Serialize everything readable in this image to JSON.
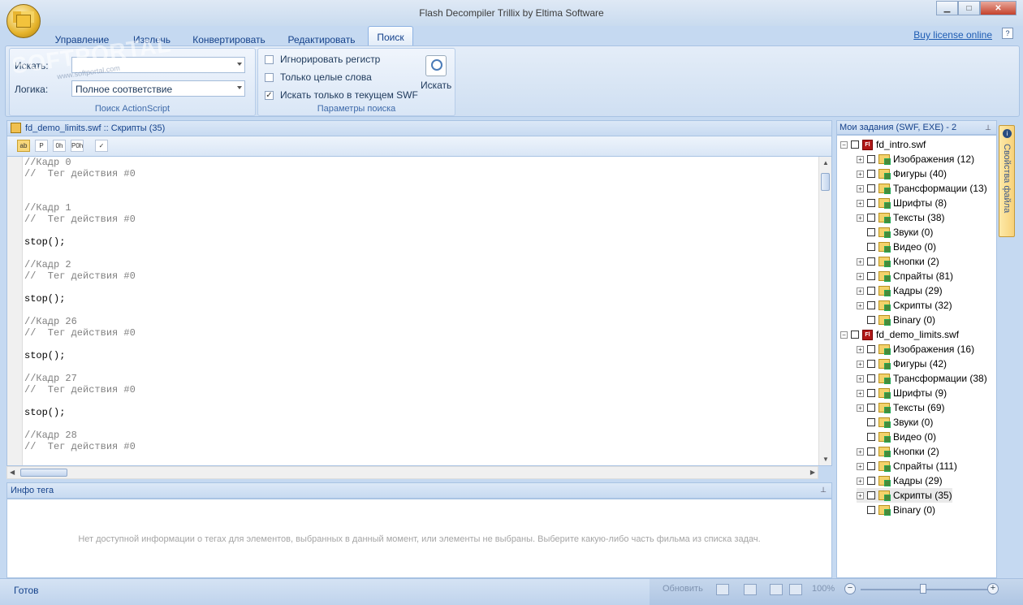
{
  "window": {
    "title": "Flash Decompiler Trillix by Eltima Software",
    "minimize": "▁",
    "maximize": "□",
    "close": "✕"
  },
  "ribbon_tabs": [
    "Управление",
    "Извлечь",
    "Конвертировать",
    "Редактировать",
    "Поиск"
  ],
  "active_tab": "Поиск",
  "buy_license": "Buy license online",
  "search_group": {
    "search_label": "Искать:",
    "search_value": "",
    "logic_label": "Логика:",
    "logic_value": "Полное соответствие",
    "group_label": "Поиск ActionScript"
  },
  "params_group": {
    "ignore_case": {
      "label": "Игнорировать регистр",
      "checked": false
    },
    "whole_words": {
      "label": "Только целые слова",
      "checked": false
    },
    "current_swf": {
      "label": "Искать только в текущем SWF",
      "checked": true
    },
    "search_button": "Искать",
    "group_label": "Параметры поиска"
  },
  "document": {
    "header": "fd_demo_limits.swf :: Скрипты (35)",
    "toolbar_buttons": [
      "ab",
      "P",
      "0h",
      "P0h",
      "✓"
    ],
    "code_lines": [
      {
        "text": "//Кадр 0",
        "kind": "comment"
      },
      {
        "text": "//  Тег действия #0",
        "kind": "comment"
      },
      {
        "text": "",
        "kind": "blank"
      },
      {
        "text": "",
        "kind": "blank"
      },
      {
        "text": "//Кадр 1",
        "kind": "comment"
      },
      {
        "text": "//  Тег действия #0",
        "kind": "comment"
      },
      {
        "text": "",
        "kind": "blank"
      },
      {
        "text": "stop();",
        "kind": "code"
      },
      {
        "text": "",
        "kind": "blank"
      },
      {
        "text": "//Кадр 2",
        "kind": "comment"
      },
      {
        "text": "//  Тег действия #0",
        "kind": "comment"
      },
      {
        "text": "",
        "kind": "blank"
      },
      {
        "text": "stop();",
        "kind": "code"
      },
      {
        "text": "",
        "kind": "blank"
      },
      {
        "text": "//Кадр 26",
        "kind": "comment"
      },
      {
        "text": "//  Тег действия #0",
        "kind": "comment"
      },
      {
        "text": "",
        "kind": "blank"
      },
      {
        "text": "stop();",
        "kind": "code"
      },
      {
        "text": "",
        "kind": "blank"
      },
      {
        "text": "//Кадр 27",
        "kind": "comment"
      },
      {
        "text": "//  Тег действия #0",
        "kind": "comment"
      },
      {
        "text": "",
        "kind": "blank"
      },
      {
        "text": "stop();",
        "kind": "code"
      },
      {
        "text": "",
        "kind": "blank"
      },
      {
        "text": "//Кадр 28",
        "kind": "comment"
      },
      {
        "text": "//  Тег действия #0",
        "kind": "comment"
      }
    ]
  },
  "info_panel": {
    "header": "Инфо тега",
    "message": "Нет доступной информации о тегах для элементов, выбранных в данный момент, или элементы не выбраны. Выберите какую-либо часть фильма из списка задач."
  },
  "tasks_panel": {
    "header": "Мои задания (SWF, EXE) - 2",
    "files": [
      {
        "name": "fd_intro.swf",
        "items": [
          "Изображения (12)",
          "Фигуры (40)",
          "Трансформации (13)",
          "Шрифты (8)",
          "Тексты (38)",
          "Звуки (0)",
          "Видео (0)",
          "Кнопки (2)",
          "Спрайты (81)",
          "Кадры (29)",
          "Скрипты (32)",
          "Binary (0)"
        ]
      },
      {
        "name": "fd_demo_limits.swf",
        "items": [
          "Изображения (16)",
          "Фигуры (42)",
          "Трансформации (38)",
          "Шрифты (9)",
          "Тексты (69)",
          "Звуки (0)",
          "Видео (0)",
          "Кнопки (2)",
          "Спрайты (111)",
          "Кадры (29)",
          "Скрипты (35)",
          "Binary (0)"
        ]
      }
    ]
  },
  "side_tab": "Свойства файла",
  "statusbar": {
    "status": "Готов",
    "refresh": "Обновить",
    "zoom": "100%"
  }
}
